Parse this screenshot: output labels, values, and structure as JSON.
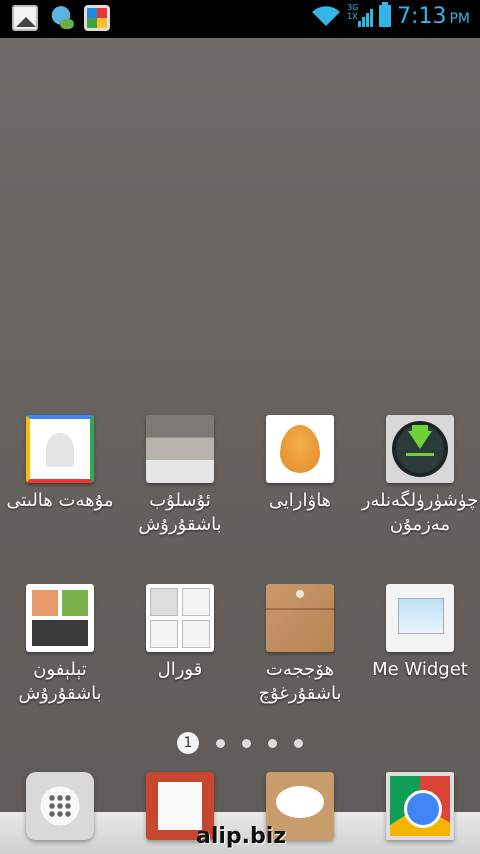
{
  "status_bar": {
    "network_label_top": "3G",
    "network_label_bottom": "1X",
    "time": "7:13",
    "ampm": "PM",
    "accent_color": "#33b5e5"
  },
  "apps_row1": [
    {
      "label": "مۇھەت ھالىتى",
      "icon": "contacts-icon"
    },
    {
      "label": "ئۇسلۇب\nباشقۇرۇش",
      "icon": "theme-icon"
    },
    {
      "label": "ھاۋارايى",
      "icon": "wallpaper-icon"
    },
    {
      "label": "چۈشۈرۈلگەنلەر\nمەزمۇن",
      "icon": "download-icon"
    }
  ],
  "apps_row2": [
    {
      "label": "تېلېفون\nباشقۇرۇش",
      "icon": "phone-manager-icon"
    },
    {
      "label": "قورال",
      "icon": "tools-icon"
    },
    {
      "label": "ھۆججەت\nباشقۇرغۇچ",
      "icon": "file-manager-icon"
    },
    {
      "label": "Me Widget",
      "icon": "widget-icon"
    }
  ],
  "pager": {
    "current": "1",
    "total_dots": 5
  },
  "dock": [
    "all-apps-icon",
    "contacts-icon",
    "messages-icon",
    "browser-icon"
  ],
  "watermark": "alip.biz"
}
